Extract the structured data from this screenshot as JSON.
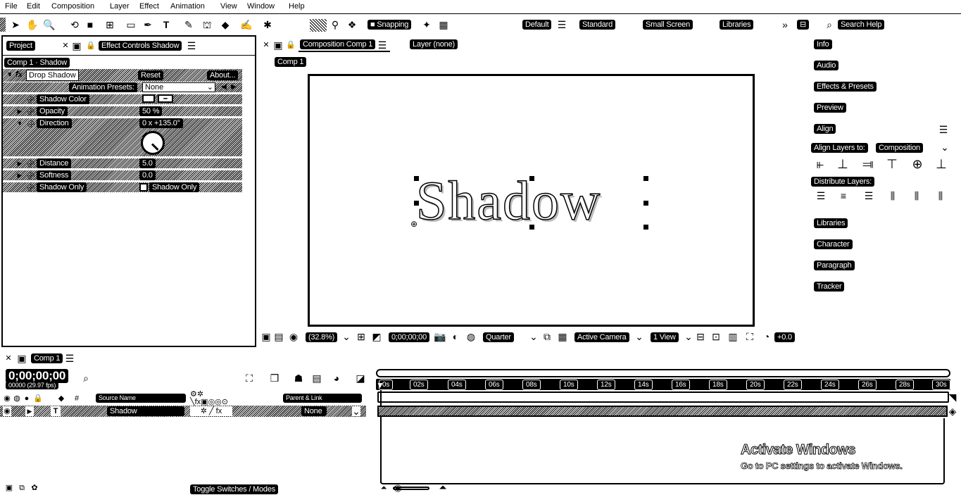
{
  "menu": [
    "File",
    "Edit",
    "Composition",
    "Layer",
    "Effect",
    "Animation",
    "View",
    "Window",
    "Help"
  ],
  "toolbar": {
    "snapping": "Snapping",
    "workspaces": [
      "Default",
      "Standard",
      "Small Screen",
      "Libraries"
    ],
    "search_help": "Search Help"
  },
  "left_panel": {
    "tab_project": "Project",
    "tab_effect_controls": "Effect Controls Shadow",
    "breadcrumb": "Comp 1 · Shadow",
    "effect": {
      "fx": "fx",
      "name": "Drop Shadow",
      "reset": "Reset",
      "about": "About..."
    },
    "animation_presets_label": "Animation Presets:",
    "animation_presets_value": "None",
    "props": [
      {
        "name": "Shadow Color",
        "value": ""
      },
      {
        "name": "Opacity",
        "value": "50 %"
      },
      {
        "name": "Direction",
        "value": "0 x +135.0°"
      },
      {
        "name": "Distance",
        "value": "5.0"
      },
      {
        "name": "Softness",
        "value": "0.0"
      },
      {
        "name": "Shadow Only",
        "value": "Shadow Only"
      }
    ]
  },
  "composition": {
    "tab": "Composition Comp 1",
    "layer_tab": "Layer (none)",
    "comp_chip": "Comp 1",
    "canvas_text": "Shadow",
    "bottom": {
      "zoom": "(32.8%)",
      "time": "0;00;00;00",
      "resolution": "Quarter",
      "camera": "Active Camera",
      "views": "1 View",
      "exposure": "+0.0"
    }
  },
  "right_panel": {
    "items": [
      "Info",
      "Audio",
      "Effects & Presets",
      "Preview"
    ],
    "align_title": "Align",
    "align_to_label": "Align Layers to:",
    "align_to_value": "Composition",
    "distribute_label": "Distribute Layers:",
    "bottom_items": [
      "Libraries",
      "Character",
      "Paragraph",
      "Tracker"
    ]
  },
  "timeline": {
    "tab": "Comp 1",
    "timecode": "0;00;00;00",
    "frames": "00000 (29.97 fps)",
    "col_source_name": "Source Name",
    "col_parent": "Parent & Link",
    "layer_name": "Shadow",
    "layer_parent": "None",
    "ruler": [
      "0s",
      "02s",
      "04s",
      "06s",
      "08s",
      "10s",
      "12s",
      "14s",
      "16s",
      "18s",
      "20s",
      "22s",
      "24s",
      "26s",
      "28s",
      "30s"
    ],
    "toggle": "Toggle Switches / Modes"
  },
  "watermark": {
    "title": "Activate Windows",
    "subtitle": "Go to PC settings to activate Windows."
  }
}
